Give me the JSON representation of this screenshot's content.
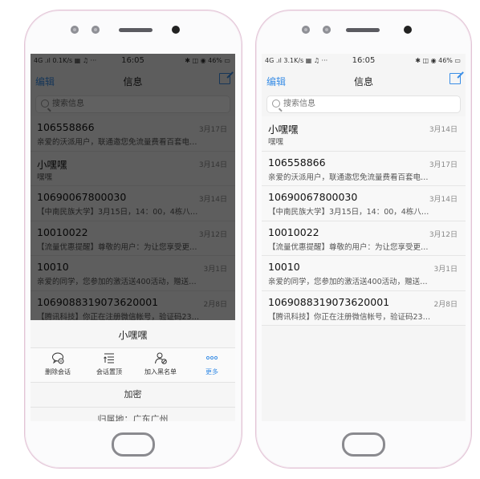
{
  "colors": {
    "accent": "#3a8ee6",
    "indicator": "#4a90e2"
  },
  "left": {
    "status": {
      "left": "4G .ıl 0.1K/s ▦ ♫ ···",
      "time": "16:05",
      "right": "✱ ◫ ◉ 46% ▭"
    },
    "navbar": {
      "edit": "编辑",
      "title": "信息",
      "compose_icon": "compose-icon"
    },
    "search": {
      "placeholder": "搜索信息"
    },
    "messages": [
      {
        "name": "106558866",
        "date": "3月17日",
        "preview": "亲爱的沃派用户，联通邀您免流量费看百套电…"
      },
      {
        "name": "小嘿嘿",
        "date": "3月14日",
        "preview": "嘿嘿"
      },
      {
        "name": "10690067800030",
        "date": "3月14日",
        "preview": "【中南民族大学】3月15日，14：00，4栋八…"
      },
      {
        "name": "10010022",
        "date": "3月12日",
        "preview": "【流量优惠提醒】尊敬的用户：为让您享受更…"
      },
      {
        "name": "10010",
        "date": "3月1日",
        "preview": "亲爱的同学，您参加的激活送400活动，赠送…"
      },
      {
        "name": "1069088319073620001",
        "date": "2月8日",
        "preview": "【腾讯科技】你正在注册微信帐号，验证码23…"
      }
    ],
    "sheet": {
      "title": "小嘿嘿",
      "actions": [
        {
          "label": "删除会话",
          "icon": "chat-delete-icon"
        },
        {
          "label": "会话置顶",
          "icon": "pin-top-icon"
        },
        {
          "label": "加入黑名单",
          "icon": "block-user-icon"
        },
        {
          "label": "更多",
          "icon": "more-dots-icon"
        }
      ],
      "option1": "加密",
      "option2": "归属地：广东广州"
    }
  },
  "right": {
    "status": {
      "left": "4G .ıl 3.1K/s ▦ ♫ ···",
      "time": "16:05",
      "right": "✱ ◫ ◉ 46% ▭"
    },
    "navbar": {
      "edit": "编辑",
      "title": "信息",
      "compose_icon": "compose-icon"
    },
    "search": {
      "placeholder": "搜索信息"
    },
    "messages": [
      {
        "name": "小嘿嘿",
        "date": "3月14日",
        "preview": "嘿嘿"
      },
      {
        "name": "106558866",
        "date": "3月17日",
        "preview": "亲爱的沃派用户，联通邀您免流量费看百套电…"
      },
      {
        "name": "10690067800030",
        "date": "3月14日",
        "preview": "【中南民族大学】3月15日，14：00，4栋八…"
      },
      {
        "name": "10010022",
        "date": "3月12日",
        "preview": "【流量优惠提醒】尊敬的用户：为让您享受更…"
      },
      {
        "name": "10010",
        "date": "3月1日",
        "preview": "亲爱的同学，您参加的激活送400活动，赠送…"
      },
      {
        "name": "1069088319073620001",
        "date": "2月8日",
        "preview": "【腾讯科技】你正在注册微信帐号，验证码23…"
      }
    ]
  }
}
